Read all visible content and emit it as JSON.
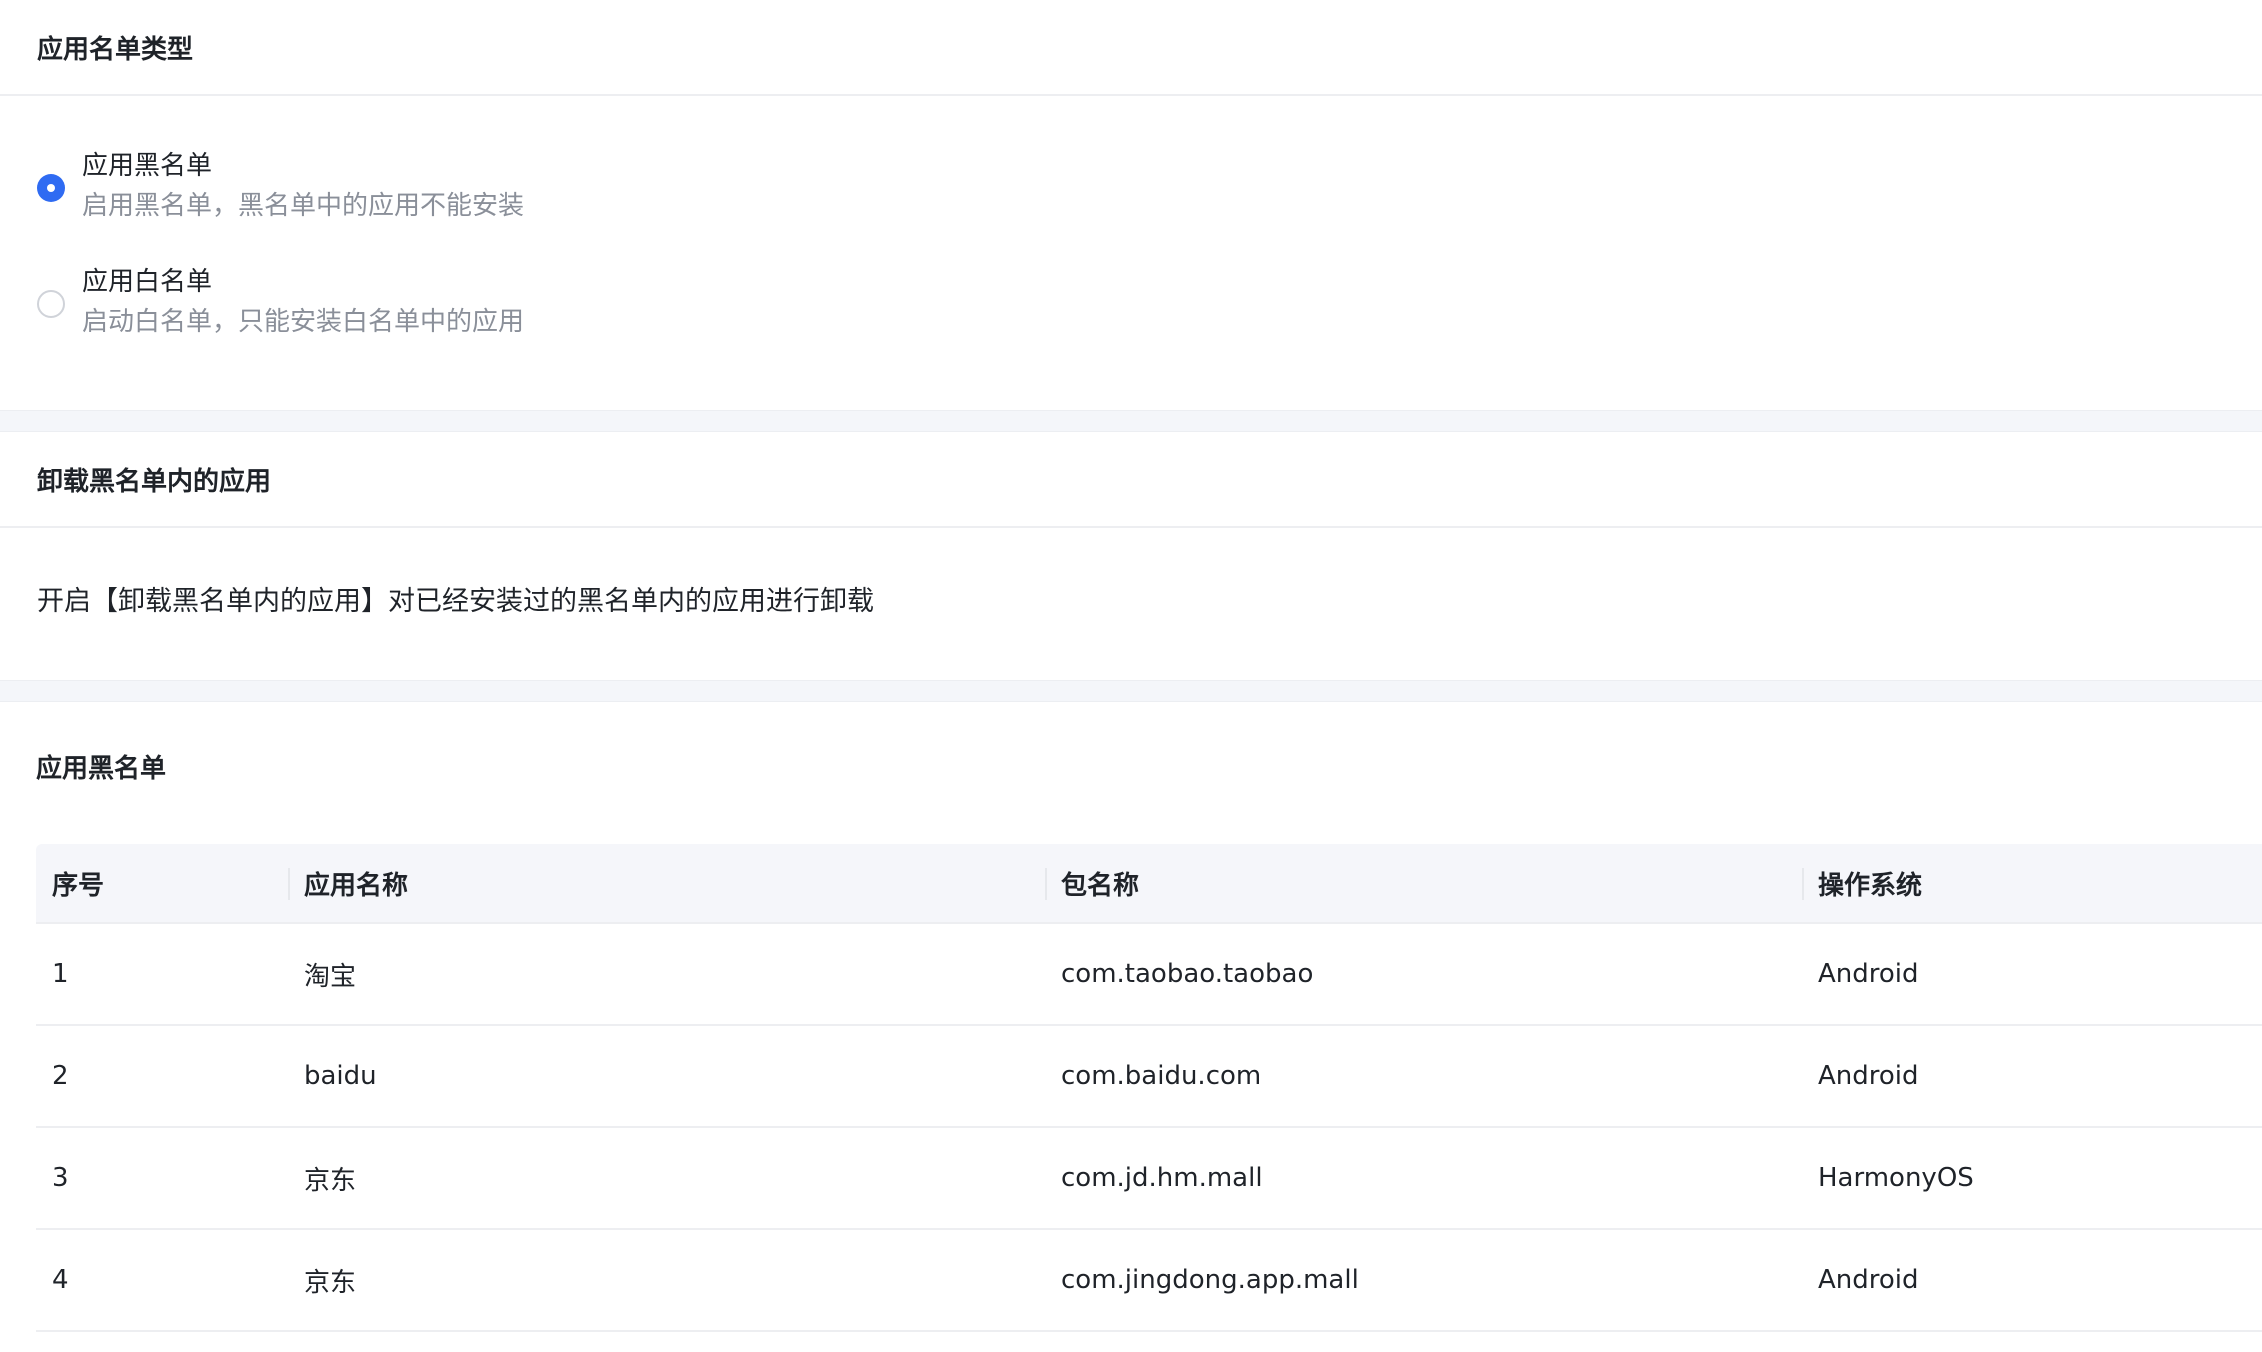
{
  "list_type": {
    "title": "应用名单类型",
    "options": [
      {
        "title": "应用黑名单",
        "desc": "启用黑名单，黑名单中的应用不能安装",
        "checked": true
      },
      {
        "title": "应用白名单",
        "desc": "启动白名单，只能安装白名单中的应用",
        "checked": false
      }
    ]
  },
  "uninstall": {
    "title": "卸载黑名单内的应用",
    "desc": "开启【卸载黑名单内的应用】对已经安装过的黑名单内的应用进行卸载"
  },
  "blacklist": {
    "title": "应用黑名单",
    "columns": [
      "序号",
      "应用名称",
      "包名称",
      "操作系统"
    ],
    "rows": [
      [
        "1",
        "淘宝",
        "com.taobao.taobao",
        "Android"
      ],
      [
        "2",
        "baidu",
        "com.baidu.com",
        "Android"
      ],
      [
        "3",
        "京东",
        "com.jd.hm.mall",
        "HarmonyOS"
      ],
      [
        "4",
        "京东",
        "com.jingdong.app.mall",
        "Android"
      ]
    ]
  },
  "colors": {
    "accent": "#2f6bf2",
    "page_background": "#f4f6fa",
    "muted_text": "#8a8f99"
  }
}
